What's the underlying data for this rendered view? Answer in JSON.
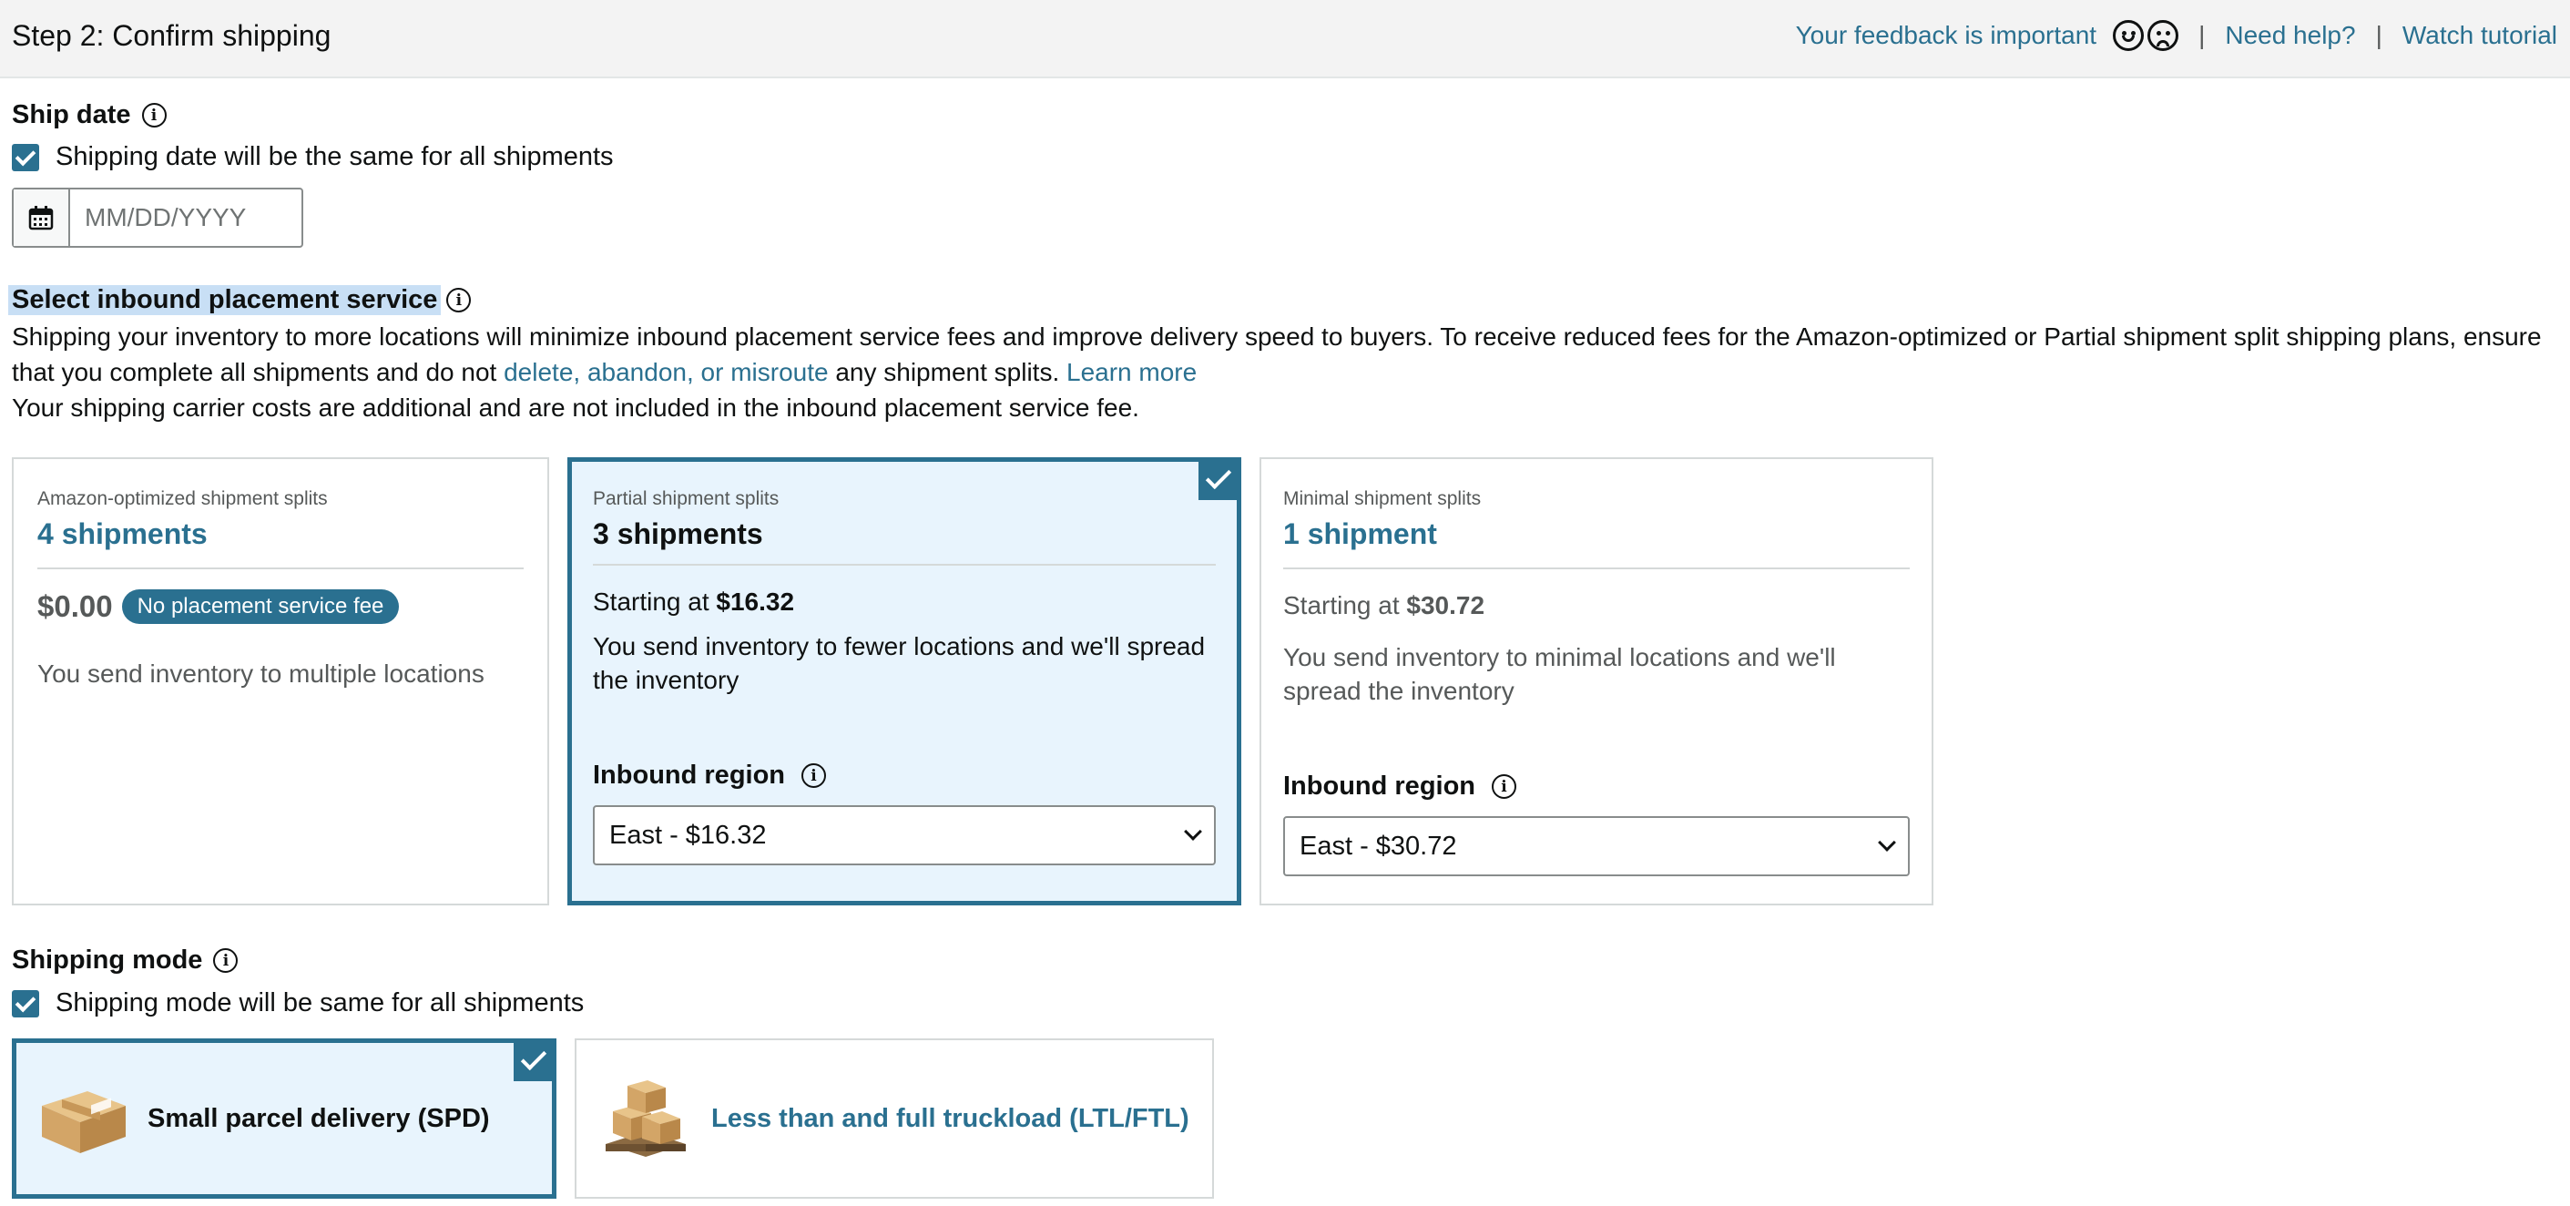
{
  "header": {
    "title": "Step 2: Confirm shipping",
    "feedback": "Your feedback is important",
    "separator": "|",
    "need_help": "Need help?",
    "watch_tutorial": "Watch tutorial"
  },
  "ship_date": {
    "label": "Ship date",
    "checkbox_label": "Shipping date will be the same for all shipments",
    "placeholder": "MM/DD/YYYY"
  },
  "placement": {
    "label": "Select inbound placement service",
    "desc_part1": "Shipping your inventory to more locations will minimize inbound placement service fees and improve delivery speed to buyers. To receive reduced fees for the Amazon-optimized or Partial shipment split shipping plans, ensure that you complete all shipments and do not ",
    "desc_link": "delete, abandon, or misroute",
    "desc_part2": " any shipment splits. ",
    "learn_more": "Learn more",
    "desc_line2": "Your shipping carrier costs are additional and are not included in the inbound placement service fee.",
    "cards": [
      {
        "sub": "Amazon-optimized shipment splits",
        "count": "4 shipments",
        "price": "$0.00",
        "badge": "No placement service fee",
        "text": "You send inventory to multiple locations"
      },
      {
        "sub": "Partial shipment splits",
        "count": "3 shipments",
        "starting": "Starting at ",
        "price": "$16.32",
        "text": "You send inventory to fewer locations and we'll spread the inventory",
        "region_label": "Inbound region",
        "region_value": "East - $16.32"
      },
      {
        "sub": "Minimal shipment splits",
        "count": "1 shipment",
        "starting": "Starting at ",
        "price": "$30.72",
        "text": "You send inventory to minimal locations and we'll spread the inventory",
        "region_label": "Inbound region",
        "region_value": "East - $30.72"
      }
    ]
  },
  "shipping_mode": {
    "label": "Shipping mode",
    "checkbox_label": "Shipping mode will be same for all shipments",
    "options": [
      {
        "label": "Small parcel delivery (SPD)"
      },
      {
        "label": "Less than and full truckload (LTL/FTL)"
      }
    ]
  },
  "colors": {
    "accent": "#2a7090",
    "selected_bg": "#e8f4fd",
    "highlight": "#c8dff5",
    "header_bg": "#f3f3f3"
  },
  "icons": [
    "smile-icon",
    "frown-icon",
    "info-icon",
    "calendar-icon",
    "checkmark-icon",
    "chevron-down-icon",
    "box-icon",
    "pallet-icon"
  ]
}
